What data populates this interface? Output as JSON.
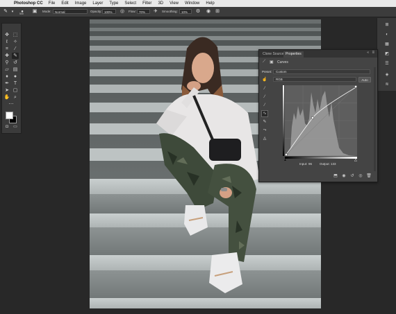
{
  "menubar": {
    "app_name": "Photoshop CC",
    "items": [
      "File",
      "Edit",
      "Image",
      "Layer",
      "Type",
      "Select",
      "Filter",
      "3D",
      "View",
      "Window",
      "Help"
    ]
  },
  "options_bar": {
    "brush_size": "500",
    "mode_label": "Mode:",
    "mode_value": "Normal",
    "opacity_label": "Opacity:",
    "opacity_value": "100%",
    "flow_label": "Flow:",
    "flow_value": "70%",
    "smoothing_label": "Smoothing:",
    "smoothing_value": "10%"
  },
  "toolbar": {
    "tools": [
      "move",
      "marquee",
      "lasso",
      "quick-select",
      "crop",
      "eyedropper",
      "healing",
      "brush",
      "stamp",
      "history-brush",
      "eraser",
      "gradient",
      "blur",
      "dodge",
      "pen",
      "type",
      "path-select",
      "shape",
      "hand",
      "zoom",
      "more"
    ],
    "foreground_color": "#ffffff",
    "background_color": "#000000"
  },
  "properties_panel": {
    "tabs": [
      "Clone Source",
      "Properties"
    ],
    "active_tab": "Properties",
    "adjustment_title": "Curves",
    "preset_label": "Preset:",
    "preset_value": "Custom",
    "channel_value": "RGB",
    "auto_button": "Auto",
    "input_label": "Input:",
    "input_value": "96",
    "output_label": "Output:",
    "output_value": "133"
  },
  "colors": {
    "panel_bg": "#444444",
    "app_bg": "#282828",
    "graph_bg": "#5e5e5e"
  }
}
